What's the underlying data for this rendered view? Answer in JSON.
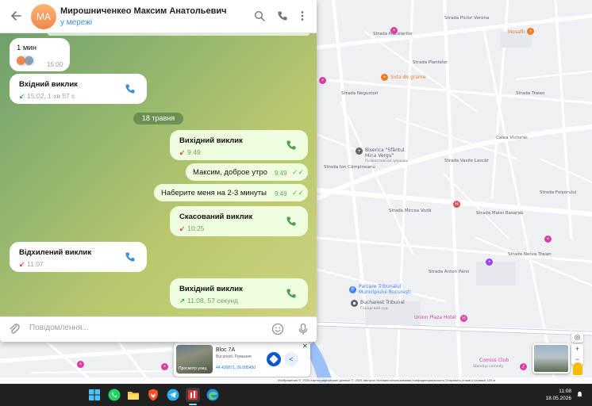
{
  "telegram": {
    "avatar_initials": "MA",
    "chat_name": "Мирошниченкео Максим Анатольевич",
    "chat_status": "у мережі",
    "composer_placeholder": "Повідомлення...",
    "colors": {
      "accent": "#3b8fd8",
      "outgoing_bubble": "#eefedf",
      "check": "#6aa35f",
      "missed": "#e14c4c"
    },
    "messages": [
      {
        "kind": "text",
        "direction": "in",
        "text": "1 мин",
        "time": "15:00"
      },
      {
        "kind": "call",
        "direction": "in",
        "title": "Вхідний виклик",
        "arrow": "↙",
        "detail": "15:02, 1 хв 57 с"
      },
      {
        "kind": "date",
        "text": "18 травня"
      },
      {
        "kind": "call",
        "direction": "out",
        "title": "Вихідний виклик",
        "arrow": "↙",
        "detail": "9:49"
      },
      {
        "kind": "text",
        "direction": "out",
        "text": "Максим, доброе утро",
        "time": "9:49"
      },
      {
        "kind": "text",
        "direction": "out",
        "text": "Наберите меня на 2-3 минуты",
        "time": "9:49"
      },
      {
        "kind": "call",
        "direction": "out",
        "title": "Скасований виклик",
        "arrow": "↙",
        "detail": "10:25"
      },
      {
        "kind": "call",
        "direction": "in",
        "title": "Відхилений виклик",
        "arrow": "↙",
        "detail": "11:07"
      },
      {
        "kind": "call",
        "direction": "out",
        "title": "Вихідний виклик",
        "arrow": "↗",
        "detail": "11:08, 57 секунд"
      }
    ]
  },
  "map": {
    "streets": [
      "Strada Măcelarilor",
      "Strada Pictor Verona",
      "Strada Ion Câmpineanu",
      "Calea Victoriei",
      "Strada Vasile Lascăr",
      "Strada Matei Basarab",
      "Strada Mircea Vodă",
      "Strada Traian",
      "Strada Plantelor",
      "Strada Foișorului",
      "Strada Nerva Traian",
      "Strada Anton Pann",
      "Strada Negustori"
    ],
    "pois": [
      {
        "name": "Mosafir",
        "color": "#f07c25",
        "icon": "restaurant-icon"
      },
      {
        "name": "Suta de grame",
        "color": "#f07c25",
        "icon": "restaurant-icon"
      },
      {
        "name": "Biserica \"Sfântul Mina Vergu\"",
        "sub": "Православная церковь",
        "color": "#5f6368",
        "icon": "church-icon"
      },
      {
        "name": "Parcare Tribunalul Municipiului București",
        "color": "#4285f4",
        "icon": "parking-icon"
      },
      {
        "name": "Bucharest Tribunal",
        "sub": "Городской суд",
        "color": "#5f6368",
        "icon": "building-icon"
      },
      {
        "name": "Union Plaza Hotel",
        "color": "#d93ea3",
        "icon": "hotel-icon"
      },
      {
        "name": "Comics Club",
        "sub": "Standup comedy",
        "color": "#d93ea3",
        "icon": "club-icon"
      }
    ],
    "place_card": {
      "thumb_label": "Просмотр улиц",
      "title": "Bloc 7A",
      "address": "București, Румыния",
      "coords": "44.426871, 26.095450",
      "close": "✕"
    },
    "controls": {
      "zoom_in": "+",
      "zoom_out": "−"
    },
    "footer": "Изображения ©, 2026 Картографические данные ©, 2026   Австрия   Условия использования   Конфиденциальность   Отправить отзыв о сервисе   100 м"
  },
  "taskbar": {
    "time": "11:08",
    "date": "18.05.2026",
    "apps": [
      "windows-start-icon",
      "whatsapp-icon",
      "file-explorer-icon",
      "brave-icon",
      "telegram-icon",
      "app-icon",
      "edge-icon"
    ]
  }
}
